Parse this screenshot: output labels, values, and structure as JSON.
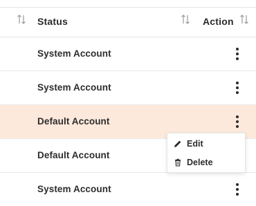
{
  "table": {
    "columns": [
      {
        "label": "Status"
      },
      {
        "label": "Action"
      }
    ],
    "rows": [
      {
        "status": "System Account"
      },
      {
        "status": "System Account"
      },
      {
        "status": "Default Account",
        "highlighted": true
      },
      {
        "status": "Default Account"
      },
      {
        "status": "System Account"
      }
    ]
  },
  "context_menu": {
    "items": [
      {
        "label": "Edit",
        "icon": "pencil-icon"
      },
      {
        "label": "Delete",
        "icon": "trash-icon"
      }
    ]
  },
  "colors": {
    "highlight_row": "#fde9dc",
    "text": "#2b2b2b",
    "sort_icon": "#9a9a9a"
  }
}
